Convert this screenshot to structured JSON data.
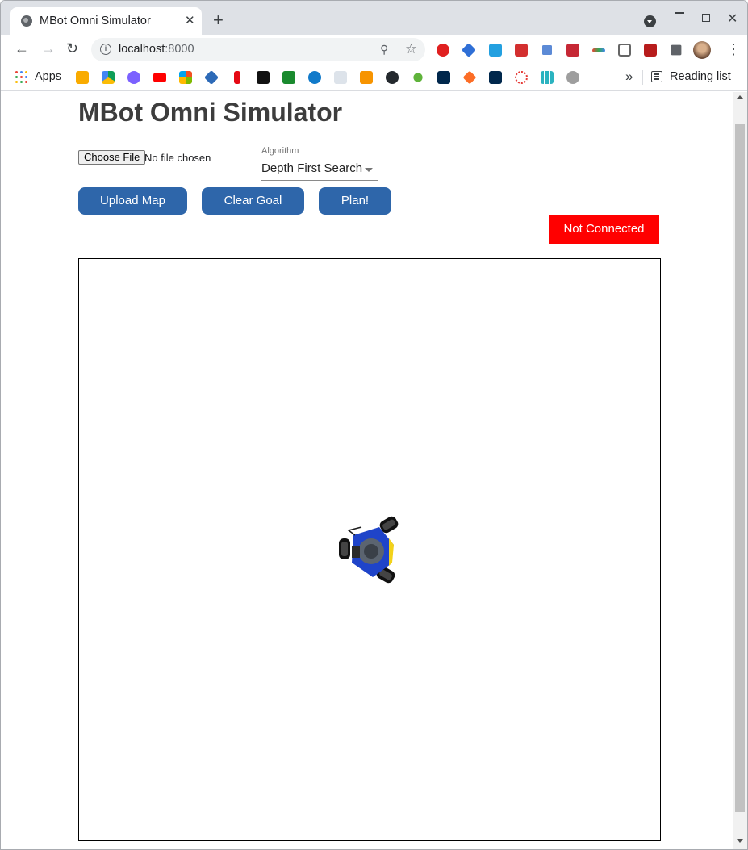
{
  "browser": {
    "tab_title": "MBot Omni Simulator",
    "tab_close": "✕",
    "new_tab": "+",
    "url_host": "localhost",
    "url_port": ":8000",
    "bookmarks_apps": "Apps",
    "reading_list": "Reading list",
    "bookmarks_more": "»"
  },
  "page": {
    "title": "MBot Omni Simulator",
    "file_input": {
      "button_label": "Choose File",
      "status": "No file chosen"
    },
    "algorithm": {
      "label": "Algorithm",
      "selected": "Depth First Search"
    },
    "buttons": {
      "upload_map": "Upload Map",
      "clear_goal": "Clear Goal",
      "plan": "Plan!"
    },
    "connection_status": "Not Connected"
  },
  "colors": {
    "button_bg": "#2e66aa",
    "status_bg": "#ff0000",
    "robot_body": "#1f44c9",
    "robot_accent": "#f3d21a"
  }
}
